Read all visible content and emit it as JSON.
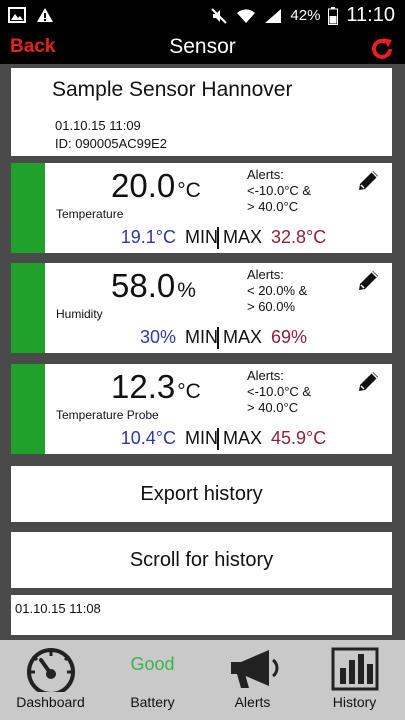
{
  "status_bar": {
    "battery_percent": "42%",
    "time": "11:10"
  },
  "header": {
    "back_label": "Back",
    "title": "Sensor"
  },
  "sensor": {
    "name": "Sample Sensor Hannover",
    "datetime": "01.10.15  11:09",
    "id": "ID: 090005AC99E2"
  },
  "readings": [
    {
      "value": "20.0",
      "unit": "°C",
      "label": "Temperature",
      "alerts": "Alerts:\n<-10.0°C &\n> 40.0°C",
      "min_value": "19.1°C",
      "min_label": "MIN",
      "max_label": "MAX",
      "max_value": "32.8°C",
      "status_color": "#1fa12a"
    },
    {
      "value": "58.0",
      "unit": "%",
      "label": "Humidity",
      "alerts": "Alerts:\n< 20.0% &\n> 60.0%",
      "min_value": "30%",
      "min_label": "MIN",
      "max_label": "MAX",
      "max_value": "69%",
      "status_color": "#1fa12a"
    },
    {
      "value": "12.3",
      "unit": "°C",
      "label": "Temperature Probe",
      "alerts": "Alerts:\n<-10.0°C &\n> 40.0°C",
      "min_value": "10.4°C",
      "min_label": "MIN",
      "max_label": "MAX",
      "max_value": "45.9°C",
      "status_color": "#1fa12a"
    }
  ],
  "actions": {
    "export_label": "Export history",
    "scroll_label": "Scroll for history"
  },
  "history": {
    "first_entry": "01.10.15  11:08"
  },
  "bottom_nav": {
    "dashboard": "Dashboard",
    "battery": "Battery",
    "battery_status": "Good",
    "alerts": "Alerts",
    "history": "History"
  },
  "colors": {
    "accent": "#e8201c",
    "status_ok": "#1fa12a",
    "min": "#2e37a8",
    "max": "#8f2233"
  }
}
